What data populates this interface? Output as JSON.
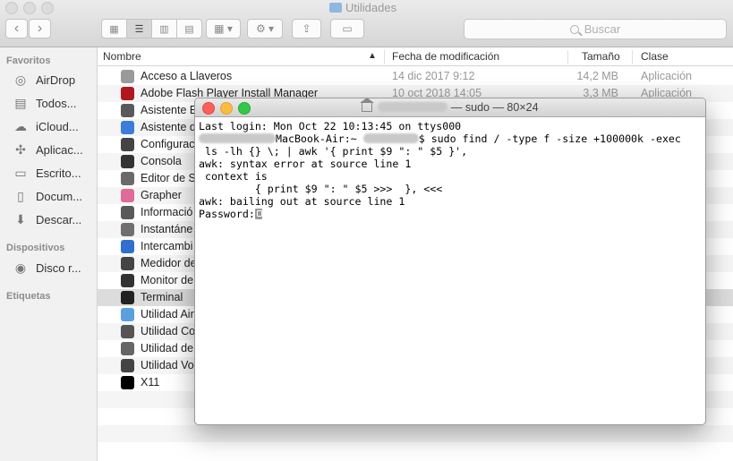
{
  "window": {
    "title": "Utilidades"
  },
  "toolbar": {
    "back": "‹",
    "forward": "›",
    "search_placeholder": "Buscar"
  },
  "sidebar": {
    "favorites_header": "Favoritos",
    "favorites": [
      {
        "label": "AirDrop",
        "icon": "airdrop-icon"
      },
      {
        "label": "Todos...",
        "icon": "all-files-icon"
      },
      {
        "label": "iCloud...",
        "icon": "cloud-icon"
      },
      {
        "label": "Aplicac...",
        "icon": "applications-icon"
      },
      {
        "label": "Escrito...",
        "icon": "desktop-icon"
      },
      {
        "label": "Docum...",
        "icon": "document-icon"
      },
      {
        "label": "Descar...",
        "icon": "download-icon"
      }
    ],
    "devices_header": "Dispositivos",
    "devices": [
      {
        "label": "Disco r...",
        "icon": "disk-icon"
      }
    ],
    "tags_header": "Etiquetas"
  },
  "columns": {
    "name": "Nombre",
    "date": "Fecha de modificación",
    "size": "Tamaño",
    "kind": "Clase"
  },
  "files": [
    {
      "name": "Acceso a Llaveros",
      "date": "14 dic 2017 9:12",
      "size": "14,2 MB",
      "kind": "Aplicación",
      "color": "#9a9a9a"
    },
    {
      "name": "Adobe Flash Player Install Manager",
      "date": "10 oct 2018 14:05",
      "size": "3,3 MB",
      "kind": "Aplicación",
      "color": "#b0171f"
    },
    {
      "name": "Asistente E",
      "color": "#5a5a5a"
    },
    {
      "name": "Asistente d",
      "color": "#3b7dd8"
    },
    {
      "name": "Configurac",
      "color": "#444444"
    },
    {
      "name": "Consola",
      "color": "#333333"
    },
    {
      "name": "Editor de S",
      "color": "#6a6a6a"
    },
    {
      "name": "Grapher",
      "color": "#e06a9a"
    },
    {
      "name": "Informació",
      "color": "#5a5a5a"
    },
    {
      "name": "Instantáne",
      "color": "#707070"
    },
    {
      "name": "Intercambi",
      "color": "#2f6fd0"
    },
    {
      "name": "Medidor de",
      "color": "#444444"
    },
    {
      "name": "Monitor de",
      "color": "#333333"
    },
    {
      "name": "Terminal",
      "color": "#222222",
      "selected": true
    },
    {
      "name": "Utilidad Air",
      "color": "#5aa0e0"
    },
    {
      "name": "Utilidad Co",
      "color": "#555555"
    },
    {
      "name": "Utilidad de",
      "color": "#666666"
    },
    {
      "name": "Utilidad Vo",
      "color": "#444444"
    },
    {
      "name": "X11",
      "color": "#000000"
    }
  ],
  "terminal": {
    "title_suffix": " — sudo — 80×24",
    "line1": "Last login: Mon Oct 22 10:13:45 on ttys000",
    "line2_host": "MacBook-Air:~ ",
    "line2_cmd": "$ sudo find / -type f -size +100000k -exec",
    "line3": " ls -lh {} \\; | awk '{ print $9 \": \" $5 }',",
    "line4": "awk: syntax error at source line 1",
    "line5": " context is",
    "line6": "\t { print $9 \": \" $5 >>>  }, <<<",
    "line7": "awk: bailing out at source line 1",
    "line8": "Password:"
  }
}
